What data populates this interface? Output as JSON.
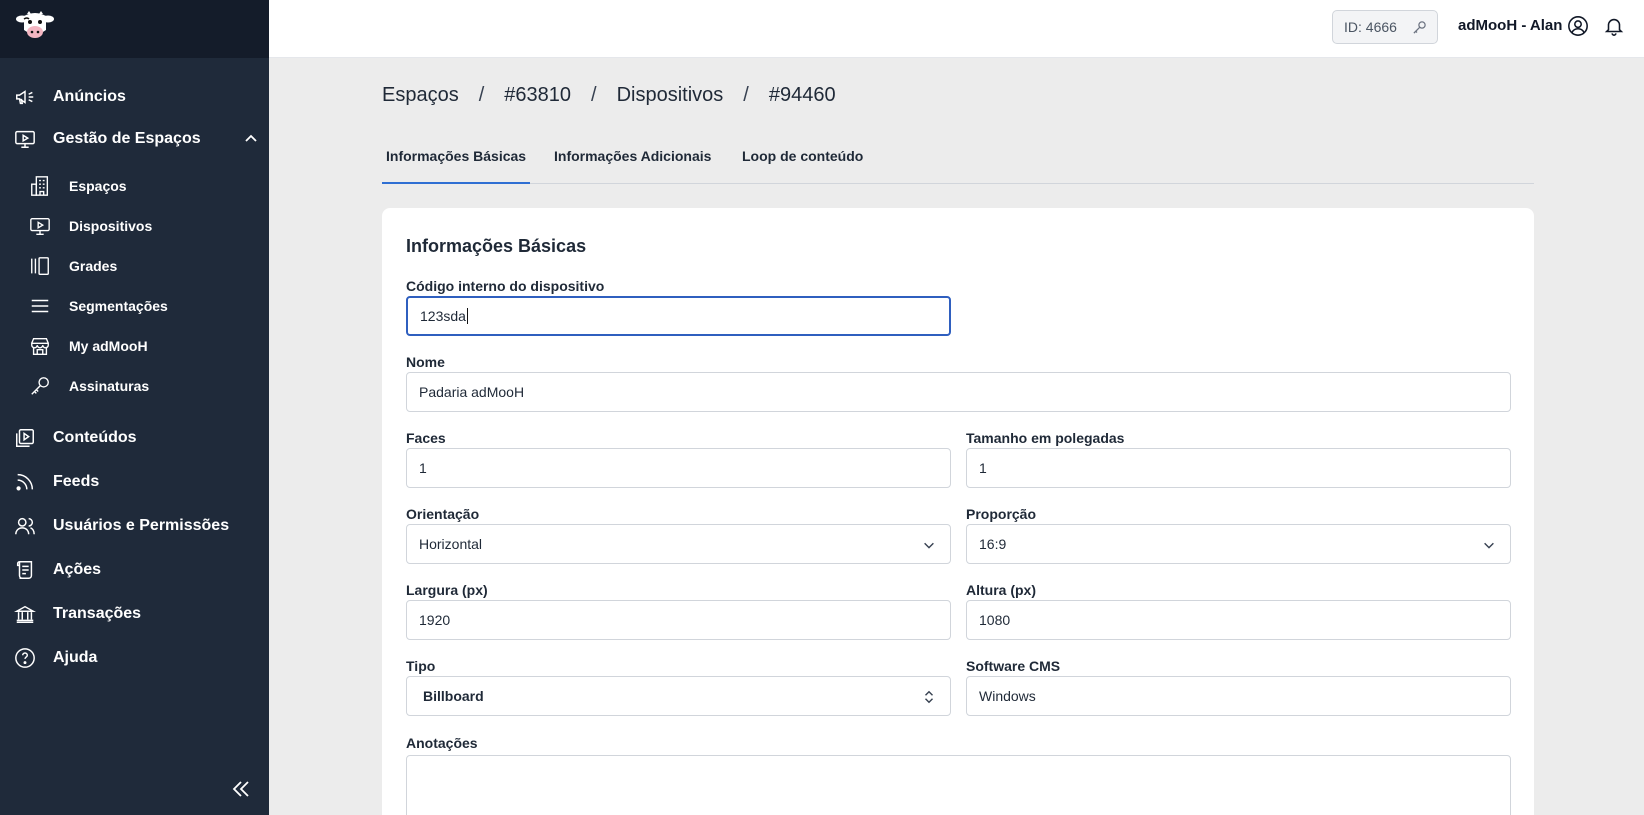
{
  "sidebar": {
    "items": [
      {
        "label": "Anúncios",
        "icon": "megaphone-icon"
      },
      {
        "label": "Gestão de Espaços",
        "icon": "monitor-play-icon",
        "expanded": true
      },
      {
        "label": "Conteúdos",
        "icon": "media-library-icon"
      },
      {
        "label": "Feeds",
        "icon": "rss-icon"
      },
      {
        "label": "Usuários e Permissões",
        "icon": "users-icon"
      },
      {
        "label": "Ações",
        "icon": "scroll-icon"
      },
      {
        "label": "Transações",
        "icon": "bank-icon"
      },
      {
        "label": "Ajuda",
        "icon": "help-circle-icon"
      }
    ],
    "subitems": [
      {
        "label": "Espaços",
        "icon": "building-icon"
      },
      {
        "label": "Dispositivos",
        "icon": "monitor-play-icon"
      },
      {
        "label": "Grades",
        "icon": "grid-columns-icon"
      },
      {
        "label": "Segmentações",
        "icon": "menu-lines-icon"
      },
      {
        "label": "My adMooH",
        "icon": "store-icon"
      },
      {
        "label": "Assinaturas",
        "icon": "key-icon"
      }
    ]
  },
  "header": {
    "id_label": "ID: 4666",
    "user_name": "adMooH - Alan"
  },
  "breadcrumb": {
    "items": [
      "Espaços",
      "#63810",
      "Dispositivos",
      "#94460"
    ],
    "separator": "/"
  },
  "tabs": [
    {
      "label": "Informações Básicas",
      "active": true
    },
    {
      "label": "Informações Adicionais",
      "active": false
    },
    {
      "label": "Loop de conteúdo",
      "active": false
    }
  ],
  "form": {
    "title": "Informações Básicas",
    "codigo": {
      "label": "Código interno do dispositivo",
      "value": "123sda"
    },
    "nome": {
      "label": "Nome",
      "value": "Padaria adMooH"
    },
    "faces": {
      "label": "Faces",
      "value": "1"
    },
    "tamanho": {
      "label": "Tamanho em polegadas",
      "value": "1"
    },
    "orientacao": {
      "label": "Orientação",
      "value": "Horizontal"
    },
    "proporcao": {
      "label": "Proporção",
      "value": "16:9"
    },
    "largura": {
      "label": "Largura (px)",
      "value": "1920"
    },
    "altura": {
      "label": "Altura (px)",
      "value": "1080"
    },
    "tipo": {
      "label": "Tipo",
      "value": "Billboard"
    },
    "software": {
      "label": "Software CMS",
      "value": "Windows"
    },
    "anotacoes": {
      "label": "Anotações",
      "value": ""
    }
  },
  "colors": {
    "sidebar_bg": "#1f2a3a",
    "logo_bar_bg": "#141c2a",
    "accent": "#2f6fd3",
    "page_bg": "#ececec"
  }
}
